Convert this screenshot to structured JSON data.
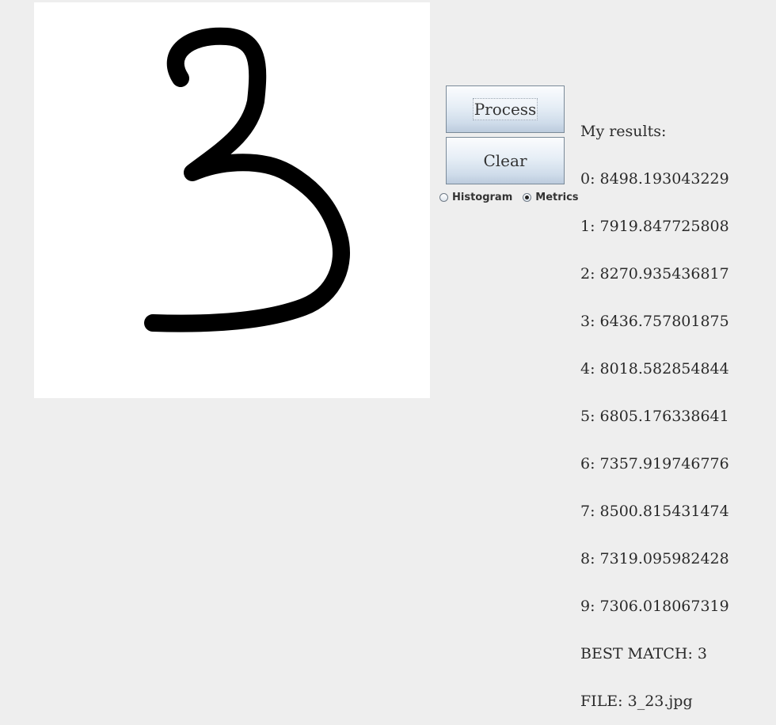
{
  "buttons": {
    "process_label": "Process",
    "clear_label": "Clear"
  },
  "options": {
    "histogram_label": "Histogram",
    "metrics_label": "Metrics",
    "selected": "Metrics"
  },
  "results": {
    "header": "My results:",
    "scores": [
      "0: 8498.193043229",
      "1: 7919.847725808",
      "2: 8270.935436817",
      "3: 6436.757801875",
      "4: 8018.582854844",
      "5: 6805.176338641",
      "6: 7357.919746776",
      "7: 8500.815431474",
      "8: 7319.095982428",
      "9: 7306.018067319"
    ],
    "best_match": "BEST MATCH: 3",
    "file": "FILE: 3_23.jpg"
  },
  "canvas": {
    "content": "handwritten-digit-3-drawing",
    "background": "#ffffff",
    "stroke_color": "#000000"
  }
}
